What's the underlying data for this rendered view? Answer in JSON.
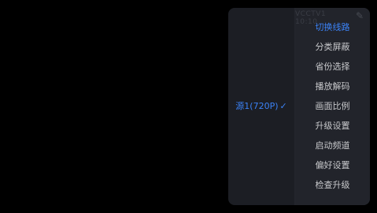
{
  "header": {
    "faint_label": "VCCTV1  10:10",
    "corner_icon": "tool-icon"
  },
  "source_panel": {
    "selected_source": "源1(720P)",
    "check_icon": "check-icon"
  },
  "menu": {
    "items": [
      {
        "label": "切换线路",
        "active": true
      },
      {
        "label": "分类屏蔽",
        "active": false
      },
      {
        "label": "省份选择",
        "active": false
      },
      {
        "label": "播放解码",
        "active": false
      },
      {
        "label": "画面比例",
        "active": false
      },
      {
        "label": "升级设置",
        "active": false
      },
      {
        "label": "启动频道",
        "active": false
      },
      {
        "label": "偏好设置",
        "active": false
      },
      {
        "label": "检查升级",
        "active": false
      }
    ]
  },
  "colors": {
    "accent": "#3b82f6",
    "panel": "#1c1e24",
    "text": "#c8c9cc"
  }
}
